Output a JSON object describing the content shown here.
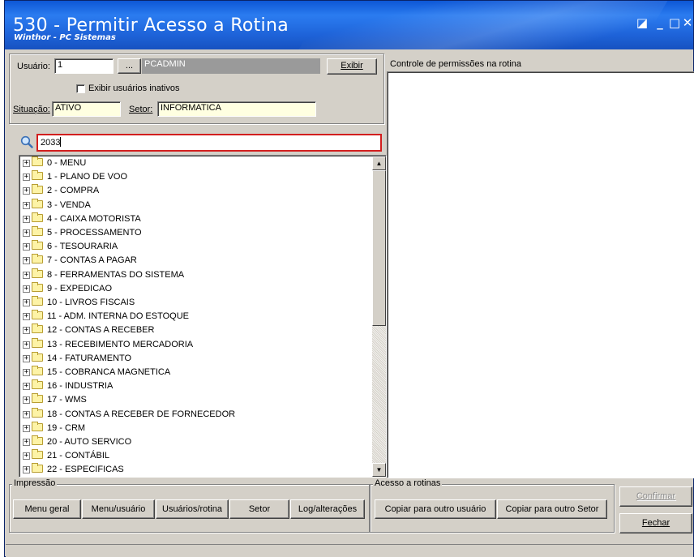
{
  "window": {
    "title": "530 - Permitir Acesso a Rotina",
    "subtitle": "Winthor - PC Sistemas",
    "controls": {
      "restore": "◪",
      "minimize": "_",
      "maximize": "□",
      "close": "✕"
    }
  },
  "user": {
    "label": "Usuário:",
    "code": "1",
    "lookup_button": "...",
    "name": "PCADMIN",
    "exibir_button": "Exibir",
    "show_inactive_label": "Exibir usuários inativos",
    "show_inactive_checked": false
  },
  "status": {
    "situacao_label": "Situação:",
    "situacao_value": "ATIVO",
    "setor_label": "Setor:",
    "setor_value": "INFORMATICA"
  },
  "search": {
    "icon": "magnifier-icon",
    "value": "2033"
  },
  "tree": {
    "items": [
      "0 - MENU",
      "1 - PLANO DE VOO",
      "2 - COMPRA",
      "3 - VENDA",
      "4 - CAIXA MOTORISTA",
      "5 - PROCESSAMENTO",
      "6 - TESOURARIA",
      "7 - CONTAS A PAGAR",
      "8 - FERRAMENTAS DO SISTEMA",
      "9 - EXPEDICAO",
      "10 - LIVROS FISCAIS",
      "11 - ADM. INTERNA DO ESTOQUE",
      "12 - CONTAS A RECEBER",
      "13 - RECEBIMENTO MERCADORIA",
      "14 - FATURAMENTO",
      "15 - COBRANCA MAGNETICA",
      "16 - INDUSTRIA",
      "17 - WMS",
      "18 - CONTAS A RECEBER DE FORNECEDOR",
      "19 - CRM",
      "20 - AUTO SERVICO",
      "21 - CONTÁBIL",
      "22 - ESPECIFICAS"
    ]
  },
  "permissions": {
    "title": "Controle de permissões na rotina"
  },
  "impressao": {
    "title": "Impressão",
    "buttons": [
      "Menu geral",
      "Menu/usuário",
      "Usuários/rotina",
      "Setor",
      "Log/alterações"
    ]
  },
  "acesso": {
    "title": "Acesso a rotinas",
    "buttons": [
      "Copiar para outro usuário",
      "Copiar para outro Setor"
    ]
  },
  "actions": {
    "confirmar": "Confirmar",
    "fechar": "Fechar"
  },
  "colors": {
    "titlebar": "#1e63d9",
    "search_border": "#d21e1e",
    "field_yellow": "#ffffe1"
  }
}
